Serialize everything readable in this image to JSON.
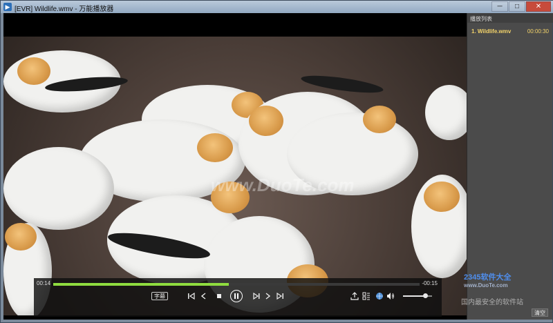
{
  "window": {
    "title": "[EVR] Wildlife.wmv - 万能播放器",
    "controls": [
      "minimize",
      "maximize",
      "close"
    ]
  },
  "video": {
    "watermark": "www.DuoTe.com"
  },
  "playback": {
    "current_time": "00:14",
    "remaining_time": "-00:15",
    "progress": 0.48,
    "volume": 0.75,
    "subtitle_label": "字幕"
  },
  "playlist": {
    "header": "播放列表",
    "items": [
      {
        "name": "1. Wildlife.wmv",
        "duration": "00:00:30"
      }
    ],
    "clear_label": "清空"
  },
  "branding": {
    "logo_text": "2345软件大全",
    "logo_sub": "www.DuoTe.com",
    "slogan": "国内最安全的软件站"
  }
}
